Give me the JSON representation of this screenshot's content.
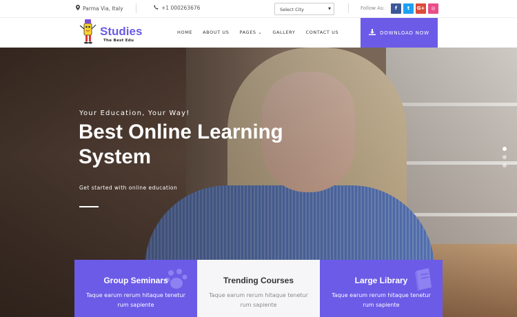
{
  "topbar": {
    "location": "Parma Via, Italy",
    "phone": "+1 000263676",
    "city_select": "Select City",
    "follow_label": "Follow As:",
    "social": [
      {
        "icon": "facebook-icon",
        "glyph": "f",
        "color": "#3b5998"
      },
      {
        "icon": "twitter-icon",
        "glyph": "t",
        "color": "#1da1f2"
      },
      {
        "icon": "google-plus-icon",
        "glyph": "G+",
        "color": "#dd4b39"
      },
      {
        "icon": "dribbble-icon",
        "glyph": "◎",
        "color": "#ea4c89"
      }
    ]
  },
  "header": {
    "logo_name": "Studies",
    "logo_tagline": "The Best Edu",
    "nav": [
      "HOME",
      "ABOUT US",
      "PAGES ⌄",
      "GALLERY",
      "CONTACT US"
    ],
    "cta_label": "DOWNLOAD NOW",
    "accent": "#6c5be7"
  },
  "hero": {
    "kicker": "Your Education, Your Way!",
    "title": "Best Online Learning System",
    "subtitle": "Get started with online education",
    "slides": 3,
    "active_slide": 1
  },
  "features": [
    {
      "title": "Group Seminars",
      "text": "Taque earum rerum hitaque tenetur rum sapiente",
      "icon": "paw-icon"
    },
    {
      "title": "Trending Courses",
      "text": "Taque earum rerum hitaque tenetur rum sapiente",
      "icon": ""
    },
    {
      "title": "Large Library",
      "text": "Taque earum rerum hitaque tenetur rum sapiente",
      "icon": "book-icon"
    }
  ]
}
